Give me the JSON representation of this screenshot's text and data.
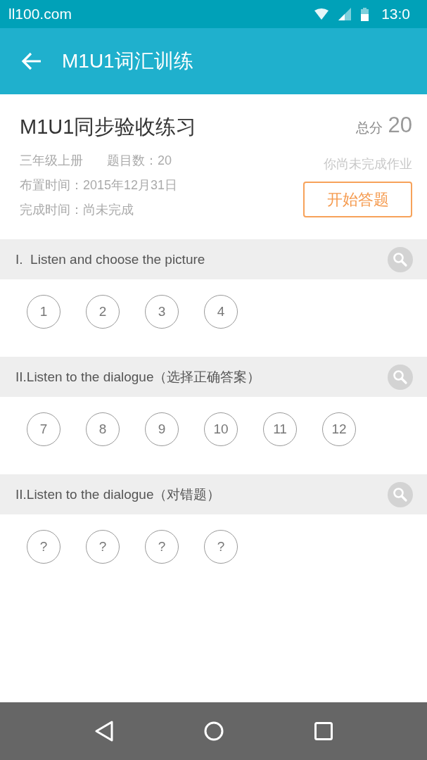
{
  "status_bar": {
    "carrier_text": "ll100.com",
    "time": "13:0"
  },
  "app_bar": {
    "title": "M1U1词汇训练"
  },
  "assignment": {
    "title": "M1U1同步验收练习",
    "grade": "三年级上册",
    "question_count": "题目数：20",
    "assigned_time": "布置时间：2015年12月31日",
    "completed_time": "完成时间：尚未完成",
    "score_label": "总分",
    "score": "20",
    "status_text": "你尚未完成作业",
    "start_button": "开始答题"
  },
  "sections": [
    {
      "title": "I.  Listen and choose the picture",
      "questions": [
        "1",
        "2",
        "3",
        "4"
      ]
    },
    {
      "title": "II.Listen to the dialogue（选择正确答案）",
      "questions": [
        "7",
        "8",
        "9",
        "10",
        "11",
        "12"
      ]
    },
    {
      "title": "II.Listen to the dialogue（对错题）",
      "questions": [
        "?",
        "?",
        "?",
        "?"
      ]
    }
  ]
}
